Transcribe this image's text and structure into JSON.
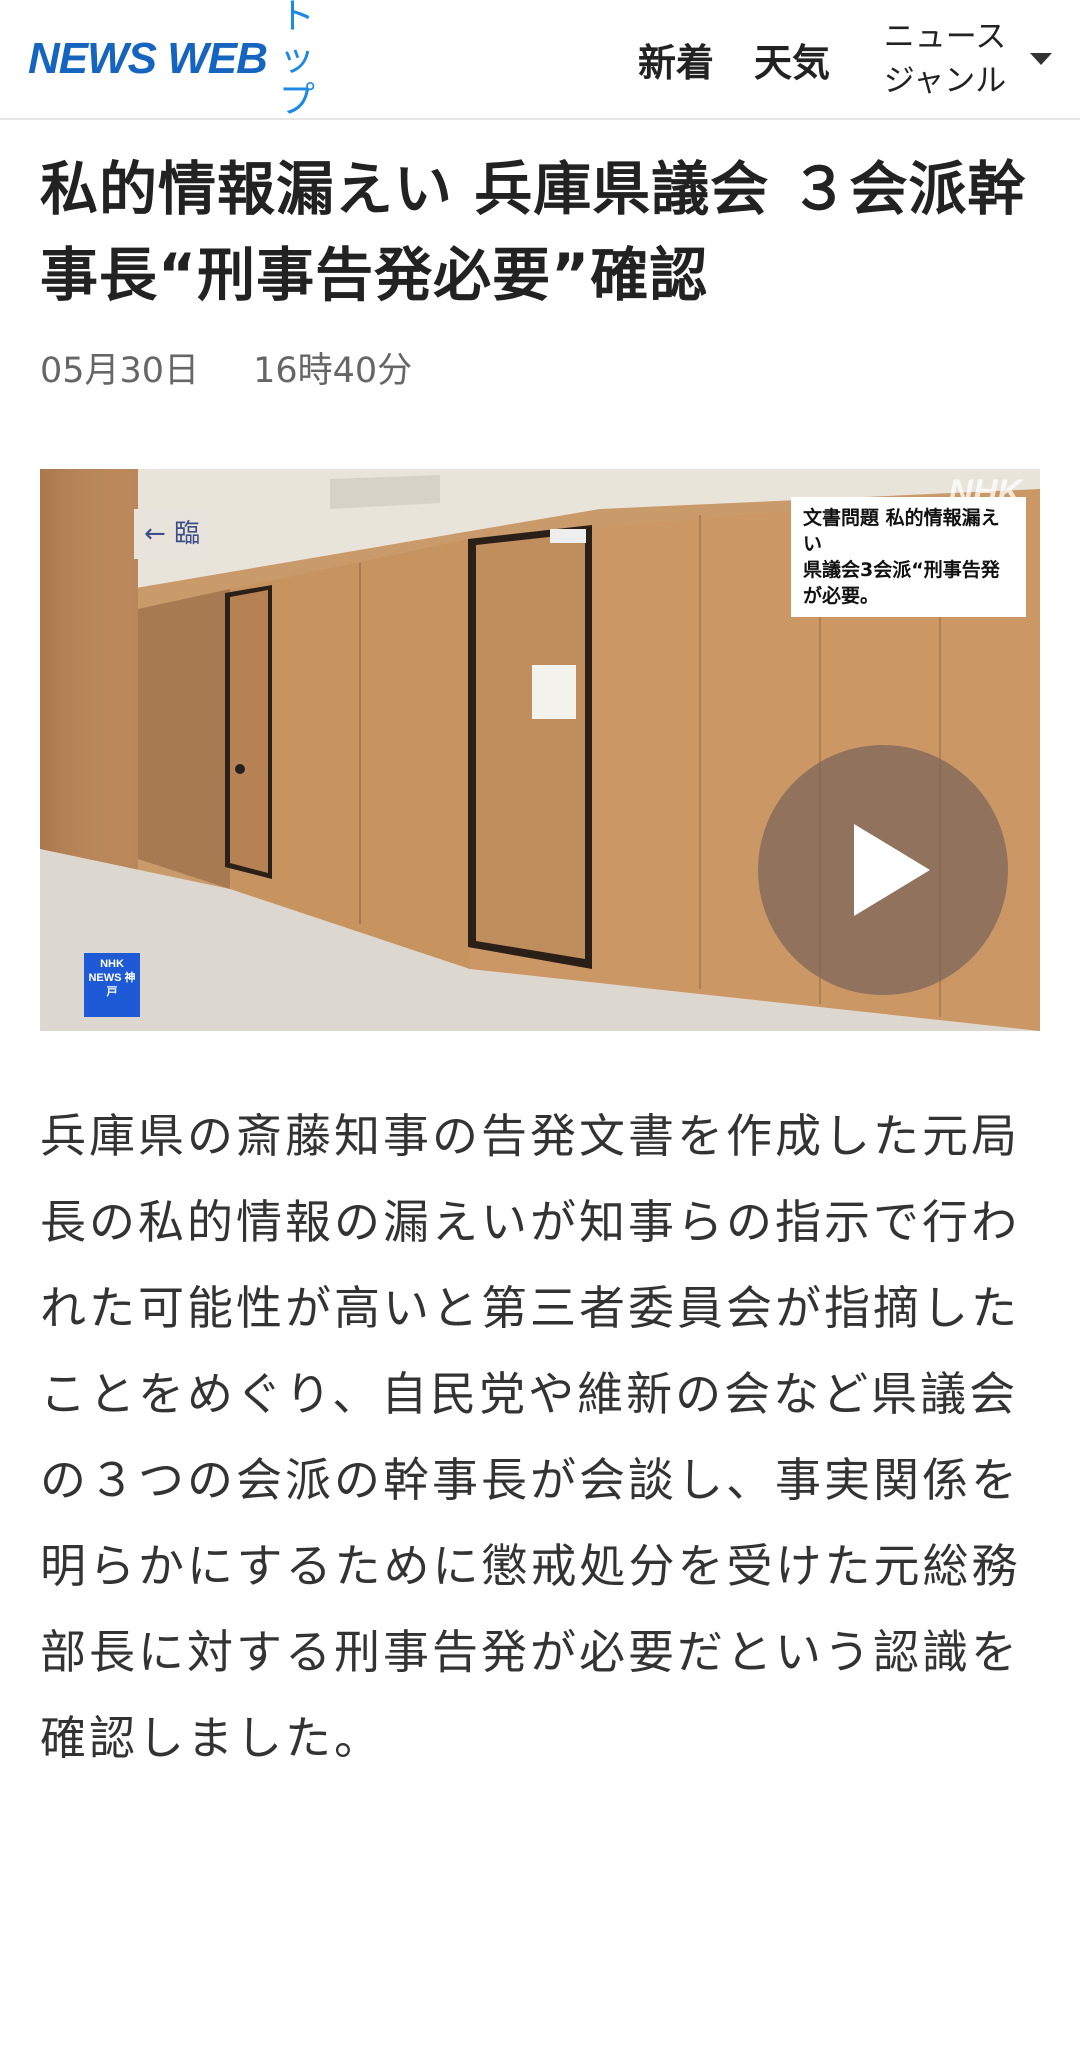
{
  "header": {
    "logo": "NEWS WEB",
    "top_label": "トップ",
    "nav": {
      "new_label": "新着",
      "weather_label": "天気",
      "genre_label": "ニュースジャンル"
    }
  },
  "article": {
    "title": "私的情報漏えい 兵庫県議会 ３会派幹事長“刑事告発必要”確認",
    "date": "05月30日",
    "time": "16時40分",
    "video": {
      "caption_line1": "文書問題 私的情報漏えい",
      "caption_line2": "県議会3会派“刑事告発が必要。",
      "watermark": "NHK",
      "badge": "NHK NEWS 神戸",
      "sign": "← 臨",
      "play_icon": "play-icon"
    },
    "body": "兵庫県の斎藤知事の告発文書を作成した元局長の私的情報の漏えいが知事らの指示で行われた可能性が高いと第三者委員会が指摘したことをめぐり、自民党や維新の会など県議会の３つの会派の幹事長が会談し、事実関係を明らかにするために懲戒処分を受けた元総務部長に対する刑事告発が必要だという認識を確認しました。"
  },
  "colors": {
    "logo": "#1565c0",
    "top_link": "#1e88e5",
    "badge": "#1f5ad6"
  }
}
